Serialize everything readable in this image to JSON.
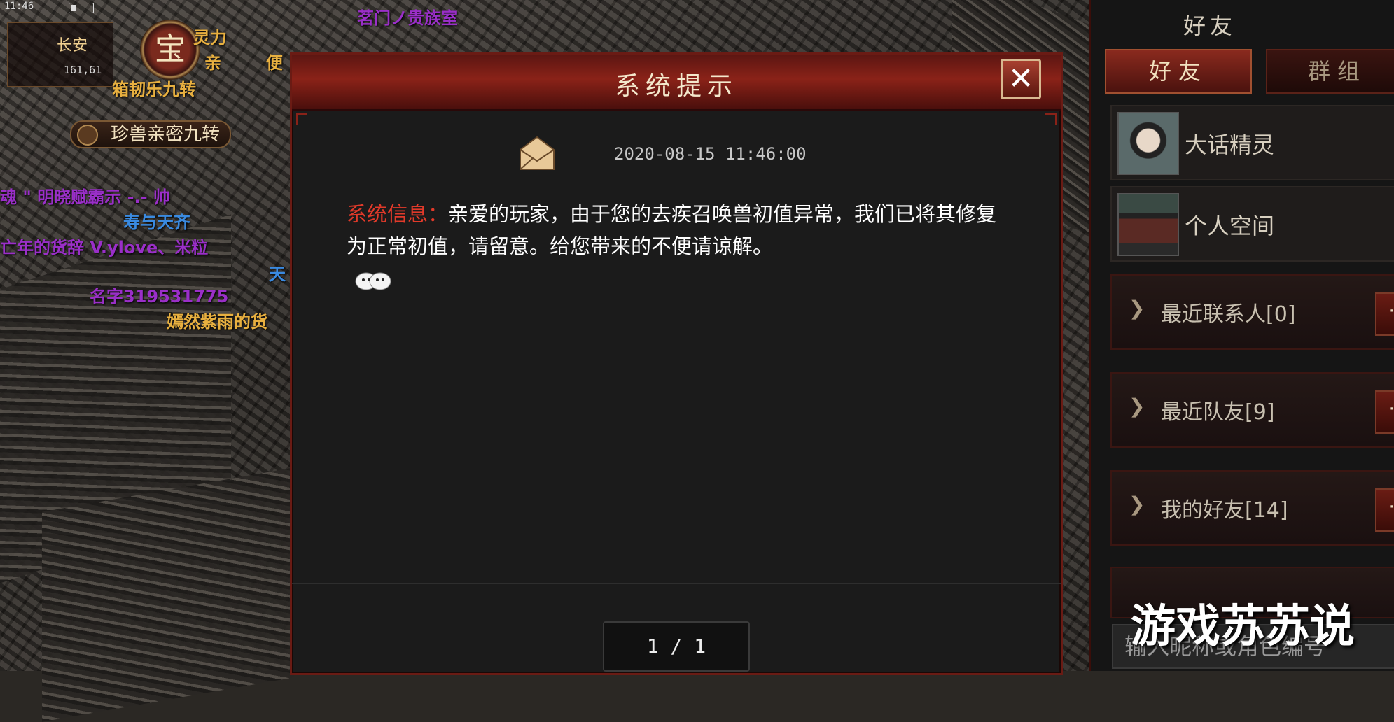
{
  "status_bar": {
    "time": "11:46"
  },
  "location": {
    "city": "长安",
    "coords": "161,61"
  },
  "treasure_button": {
    "label": "宝"
  },
  "scene_texts": [
    {
      "text": "茗门ノ贵族室",
      "color": "#9a2fc8"
    },
    {
      "text": "灵力",
      "color": "#e8b040"
    },
    {
      "text": "亲",
      "color": "#e8b040"
    },
    {
      "text": "便",
      "color": "#e8b040"
    },
    {
      "text": "箱韧乐九转",
      "color": "#e8b040"
    },
    {
      "text": "魂 \" 明晓赋霸示 -.- 帅",
      "color": "#9a2fc8"
    },
    {
      "text": "寿与天齐",
      "color": "#3a8ae0"
    },
    {
      "text": "亡年的货辞 V.ylove、米粒",
      "color": "#9a2fc8"
    },
    {
      "text": "天",
      "color": "#3a8ae0"
    },
    {
      "text": "名字319531775",
      "color": "#9a2fc8"
    },
    {
      "text": "嫣然紫雨的货",
      "color": "#e8b040"
    }
  ],
  "scene_pills": [
    {
      "label": "珍兽亲密九转"
    }
  ],
  "dialog": {
    "title": "系统提示",
    "close_label": "✕",
    "datetime": "2020-08-15 11:46:00",
    "message_label": "系统信息：",
    "message_body": "亲爱的玩家，由于您的去疾召唤兽初值异常，我们已将其修复为正常初值，请留意。给您带来的不便请谅解。",
    "pager": "1 / 1",
    "icons": {
      "mail": "envelope-icon",
      "emoji": "emoji-icon"
    }
  },
  "friends_panel": {
    "title": "好友",
    "tabs": [
      {
        "label": "好友",
        "active": true
      },
      {
        "label": "群组",
        "active": false
      }
    ],
    "contacts": [
      {
        "name": "大话精灵",
        "icon": "avatar-icon"
      },
      {
        "name": "个人空间",
        "icon": "house-icon"
      }
    ],
    "groups": [
      {
        "name": "最近联系人",
        "count": "[0]"
      },
      {
        "name": "最近队友",
        "count": "[9]"
      },
      {
        "name": "我的好友",
        "count": "[14]"
      }
    ],
    "search_placeholder": "输入昵称或角色编号",
    "more_label": "···"
  },
  "watermark": "游戏苏苏说",
  "colors": {
    "accent_red": "#8a2218",
    "label_red": "#e23a2a",
    "gold": "#f0d090"
  }
}
